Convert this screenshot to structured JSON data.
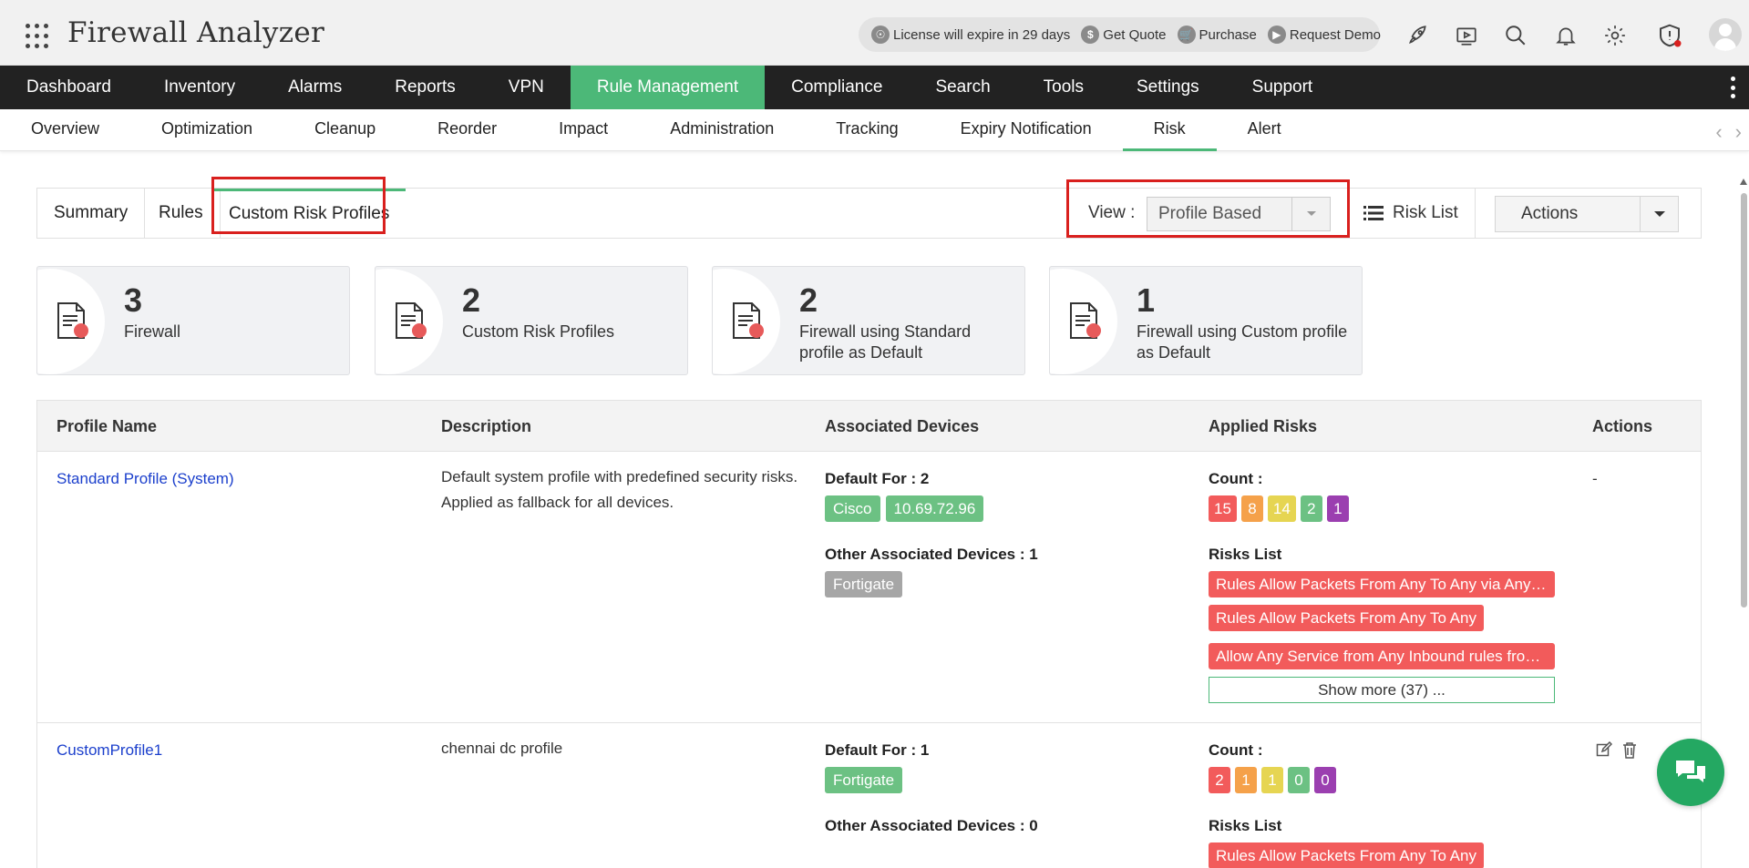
{
  "app": {
    "title": "Firewall Analyzer"
  },
  "header": {
    "license": "License will expire in 29 days",
    "get_quote": "Get Quote",
    "purchase": "Purchase",
    "request_demo": "Request Demo"
  },
  "main_nav": [
    {
      "label": "Dashboard"
    },
    {
      "label": "Inventory"
    },
    {
      "label": "Alarms"
    },
    {
      "label": "Reports"
    },
    {
      "label": "VPN"
    },
    {
      "label": "Rule Management"
    },
    {
      "label": "Compliance"
    },
    {
      "label": "Search"
    },
    {
      "label": "Tools"
    },
    {
      "label": "Settings"
    },
    {
      "label": "Support"
    }
  ],
  "main_nav_active": "Rule Management",
  "sub_nav": [
    {
      "label": "Overview"
    },
    {
      "label": "Optimization"
    },
    {
      "label": "Cleanup"
    },
    {
      "label": "Reorder"
    },
    {
      "label": "Impact"
    },
    {
      "label": "Administration"
    },
    {
      "label": "Tracking"
    },
    {
      "label": "Expiry Notification"
    },
    {
      "label": "Risk"
    },
    {
      "label": "Alert"
    }
  ],
  "sub_nav_active": "Risk",
  "tabs": {
    "summary": "Summary",
    "rules": "Rules",
    "custom": "Custom Risk Profiles"
  },
  "view": {
    "label": "View :",
    "selected": "Profile Based"
  },
  "risk_list": "Risk List",
  "actions": "Actions",
  "cards": [
    {
      "count": "3",
      "label": "Firewall"
    },
    {
      "count": "2",
      "label": "Custom Risk Profiles"
    },
    {
      "count": "2",
      "label": "Firewall using Standard profile as Default"
    },
    {
      "count": "1",
      "label": "Firewall using Custom profile as Default"
    }
  ],
  "table": {
    "headers": {
      "profile_name": "Profile Name",
      "description": "Description",
      "associated_devices": "Associated Devices",
      "applied_risks": "Applied Risks",
      "actions": "Actions"
    },
    "rows": [
      {
        "name": "Standard Profile (System)",
        "description": "Default system profile with predefined security risks. Applied as fallback for all devices.",
        "default_for": "Default For : 2",
        "default_devices": [
          "Cisco",
          "10.69.72.96"
        ],
        "other_label": "Other Associated Devices : 1",
        "other_devices": [
          "Fortigate"
        ],
        "count_label": "Count :",
        "counts": [
          "15",
          "8",
          "14",
          "2",
          "1"
        ],
        "risks_label": "Risks List",
        "risks": [
          "Rules Allow Packets From Any To Any via Any Service",
          "Rules Allow Packets From Any To Any",
          "Allow Any Service from Any Inbound rules from Internet"
        ],
        "show_more": "Show more (37) ...",
        "actions": "-"
      },
      {
        "name": "CustomProfile1",
        "description": "chennai dc profile",
        "default_for": "Default For : 1",
        "default_devices": [
          "Fortigate"
        ],
        "other_label": "Other Associated Devices : 0",
        "count_label": "Count :",
        "counts": [
          "2",
          "1",
          "1",
          "0",
          "0"
        ],
        "risks_label": "Risks List",
        "risks": [
          "Rules Allow Packets From Any To Any"
        ]
      }
    ]
  },
  "colors": {
    "accent": "#4cb878",
    "nav_bg": "#222222",
    "highlight": "#d9201e",
    "link": "#1b3fcc",
    "count_colors": [
      "#f25b5b",
      "#f5a14a",
      "#e6d552",
      "#6cc183",
      "#9b3fb0"
    ],
    "device_default": "#6cc183",
    "device_other": "#a6a6a6"
  }
}
